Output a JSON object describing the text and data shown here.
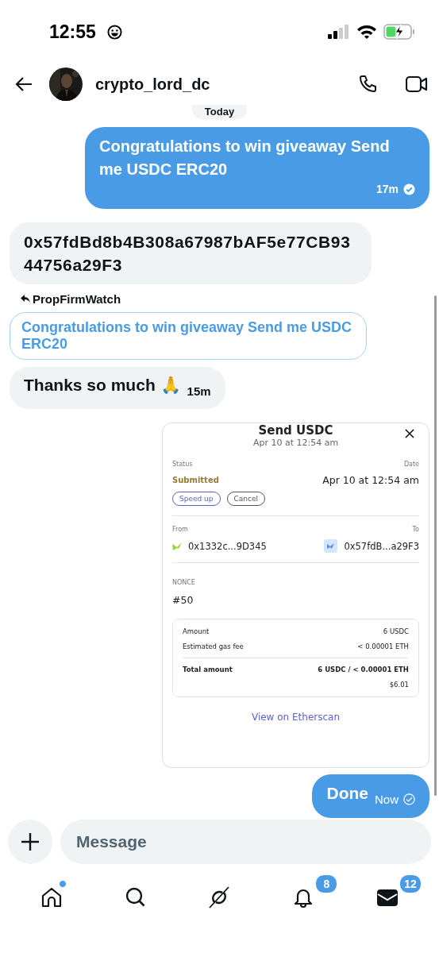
{
  "status_bar": {
    "time": "12:55"
  },
  "header": {
    "username": "crypto_lord_dc"
  },
  "date_divider": "Today",
  "messages": [
    {
      "kind": "text",
      "outgoing": true,
      "text": "Congratulations to win giveaway Send me USDC ERC20",
      "time": "17m",
      "read": true
    },
    {
      "kind": "text",
      "outgoing": false,
      "text": "0x57fdBd8b4B308a67987bAF5e77CB9344756a29F3"
    },
    {
      "kind": "reply",
      "outgoing": false,
      "reply_to": "PropFirmWatch",
      "quote": "Congratulations to win giveaway Send me USDC ERC20",
      "text": "Thanks so much 🙏",
      "time": "15m"
    },
    {
      "kind": "transaction",
      "outgoing": true,
      "title": "Send USDC",
      "subtitle": "Apr 10 at 12:54 am",
      "status_label": "Status",
      "status": "Submitted",
      "date_label": "Date",
      "date": "Apr 10 at 12:54 am",
      "actions": [
        "Speed up",
        "Cancel"
      ],
      "from_label": "From",
      "from": "0x1332c...9D345",
      "to_label": "To",
      "to": "0x57fdB...a29F3",
      "nonce_label": "NONCE",
      "nonce": "#50",
      "rows": [
        {
          "label": "Amount",
          "value": "6 USDC"
        },
        {
          "label": "Estimated gas fee",
          "value": "< 0.00001 ETH"
        }
      ],
      "total": {
        "label": "Total amount",
        "value": "6 USDC / < 0.00001 ETH",
        "fiat": "$6.01"
      },
      "link": "View on Etherscan"
    },
    {
      "kind": "text",
      "outgoing": true,
      "text": "Done",
      "time": "Now",
      "read": false
    }
  ],
  "composer": {
    "placeholder": "Message"
  },
  "tabs": [
    {
      "kind": "home",
      "selected": false,
      "dot": true
    },
    {
      "kind": "search",
      "selected": false
    },
    {
      "kind": "slash",
      "selected": false
    },
    {
      "kind": "bell",
      "selected": false,
      "badge": "8"
    },
    {
      "kind": "mail",
      "selected": true,
      "badge": "12"
    }
  ]
}
